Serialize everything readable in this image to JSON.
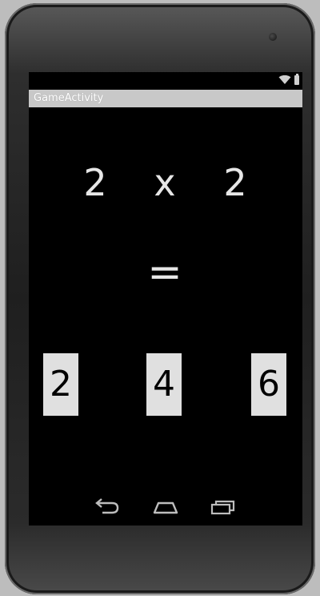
{
  "app": {
    "title": "GameActivity"
  },
  "question": {
    "left_operand": "2",
    "operator": "x",
    "right_operand": "2",
    "equals": "="
  },
  "answers": [
    {
      "label": "2"
    },
    {
      "label": "4"
    },
    {
      "label": "6"
    }
  ],
  "status_icons": [
    "wifi-icon",
    "battery-icon"
  ],
  "nav": {
    "buttons": [
      "back-icon",
      "home-icon",
      "recent-apps-icon"
    ]
  },
  "colors": {
    "screen_background": "#000000",
    "titlebar_background": "#c8c8c8",
    "answer_button_background": "#e0e0e0",
    "question_text": "#e6e6e6"
  }
}
